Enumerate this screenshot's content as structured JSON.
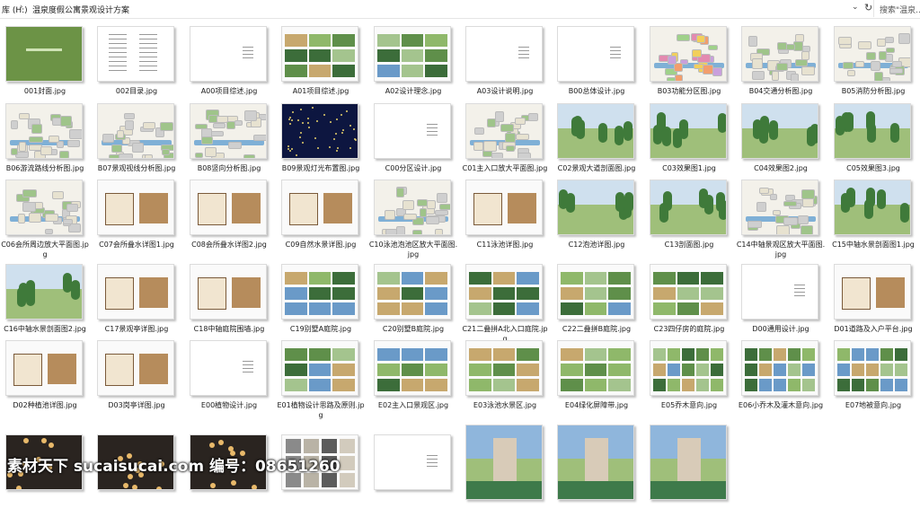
{
  "address_bar": {
    "drive": "库 (H:)",
    "separator": "›",
    "folder": "温泉度假公寓景观设计方案",
    "search_placeholder": "搜索\"温泉..."
  },
  "files": [
    {
      "name": "001封面.jpg",
      "thumb": "cover"
    },
    {
      "name": "002目录.jpg",
      "thumb": "toc"
    },
    {
      "name": "A00项目综述.jpg",
      "thumb": "text"
    },
    {
      "name": "A01项目综述.jpg",
      "thumb": "collage"
    },
    {
      "name": "A02设计理念.jpg",
      "thumb": "collage"
    },
    {
      "name": "A03设计说明.jpg",
      "thumb": "text"
    },
    {
      "name": "B00总体设计.jpg",
      "thumb": "text"
    },
    {
      "name": "B03功能分区图.jpg",
      "thumb": "plan-color"
    },
    {
      "name": "B04交通分析图.jpg",
      "thumb": "plan"
    },
    {
      "name": "B05消防分析图.jpg",
      "thumb": "plan"
    },
    {
      "name": "B06游流路线分析图.jpg",
      "thumb": "plan"
    },
    {
      "name": "B07景观视线分析图.jpg",
      "thumb": "plan"
    },
    {
      "name": "B08竖向分析图.jpg",
      "thumb": "plan"
    },
    {
      "name": "B09景观灯光布置图.jpg",
      "thumb": "night"
    },
    {
      "name": "C00分区设计.jpg",
      "thumb": "text"
    },
    {
      "name": "C01主入口放大平面图.jpg",
      "thumb": "plan"
    },
    {
      "name": "C02景观大道剖面图.jpg",
      "thumb": "photo"
    },
    {
      "name": "C03效果图1.jpg",
      "thumb": "photo"
    },
    {
      "name": "C04效果图2.jpg",
      "thumb": "photo"
    },
    {
      "name": "C05效果图3.jpg",
      "thumb": "photo"
    },
    {
      "name": "C06会所周边放大平面图.jpg",
      "thumb": "plan"
    },
    {
      "name": "C07会所叠水详图1.jpg",
      "thumb": "sheet"
    },
    {
      "name": "C08会所叠水详图2.jpg",
      "thumb": "sheet"
    },
    {
      "name": "C09自然水景详图.jpg",
      "thumb": "sheet"
    },
    {
      "name": "C10泳池泡池区放大平面图.jpg",
      "thumb": "plan"
    },
    {
      "name": "C11泳池详图.jpg",
      "thumb": "sheet"
    },
    {
      "name": "C12泡池详图.jpg",
      "thumb": "photo"
    },
    {
      "name": "C13剖面图.jpg",
      "thumb": "photo"
    },
    {
      "name": "C14中轴景观区放大平面图.jpg",
      "thumb": "plan"
    },
    {
      "name": "C15中轴水景剖面图1.jpg",
      "thumb": "photo"
    },
    {
      "name": "C16中轴水景剖面图2.jpg",
      "thumb": "photo"
    },
    {
      "name": "C17景观亭详图.jpg",
      "thumb": "sheet"
    },
    {
      "name": "C18中轴庭院围墙.jpg",
      "thumb": "sheet"
    },
    {
      "name": "C19别墅A庭院.jpg",
      "thumb": "collage"
    },
    {
      "name": "C20别墅B庭院.jpg",
      "thumb": "collage"
    },
    {
      "name": "C21二叠拼A北入口庭院.jpg",
      "thumb": "collage"
    },
    {
      "name": "C22二叠拼B庭院.jpg",
      "thumb": "collage"
    },
    {
      "name": "C23四仔房的庭院.jpg",
      "thumb": "collage"
    },
    {
      "name": "D00通用设计.jpg",
      "thumb": "text"
    },
    {
      "name": "D01道路及入户平台.jpg",
      "thumb": "sheet"
    },
    {
      "name": "D02种植池详图.jpg",
      "thumb": "sheet"
    },
    {
      "name": "D03岗亭详图.jpg",
      "thumb": "sheet"
    },
    {
      "name": "E00植物设计.jpg",
      "thumb": "text"
    },
    {
      "name": "E01植物设计思路及原则.jpg",
      "thumb": "collage"
    },
    {
      "name": "E02主入口景观区.jpg",
      "thumb": "collage"
    },
    {
      "name": "E03泳池水景区.jpg",
      "thumb": "collage"
    },
    {
      "name": "E04绿化屏障带.jpg",
      "thumb": "collage"
    },
    {
      "name": "E05乔木意向.jpg",
      "thumb": "plants"
    },
    {
      "name": "E06小乔木及灌木意向.jpg",
      "thumb": "plants"
    },
    {
      "name": "E07地被意向.jpg",
      "thumb": "plants"
    },
    {
      "name": "",
      "thumb": "dark"
    },
    {
      "name": "",
      "thumb": "dark"
    },
    {
      "name": "",
      "thumb": "dark"
    },
    {
      "name": "",
      "thumb": "stone"
    },
    {
      "name": "",
      "thumb": "text"
    },
    {
      "name": "",
      "thumb": "tower"
    },
    {
      "name": "",
      "thumb": "tower"
    },
    {
      "name": "",
      "thumb": "tower"
    }
  ],
  "watermark": "素材天下 sucaisucai.com 编号：08651260"
}
